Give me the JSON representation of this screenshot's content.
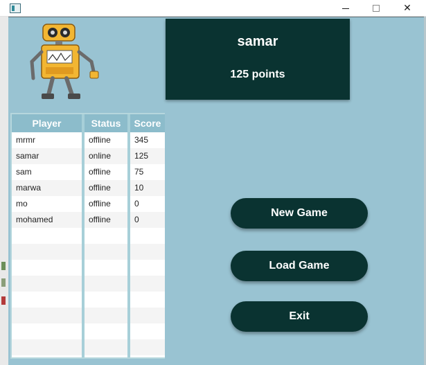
{
  "window": {
    "controls": {
      "minimize": "—",
      "maximize": "☐",
      "close": "✕"
    },
    "icon": "app-window-icon"
  },
  "colors": {
    "background": "#99c3d2",
    "card": "#0a3331",
    "table_header": "#8cbccb",
    "text_light": "#ffffff"
  },
  "header": {
    "player_name": "samar",
    "points": "125 points"
  },
  "mascot": {
    "icon": "robot-mascot-icon"
  },
  "table": {
    "columns": [
      "Player",
      "Status",
      "Score"
    ],
    "rows": [
      {
        "player": "mrmr",
        "status": "offline",
        "score": "345"
      },
      {
        "player": "samar",
        "status": "online",
        "score": "125"
      },
      {
        "player": "sam",
        "status": "offline",
        "score": "75"
      },
      {
        "player": "marwa",
        "status": "offline",
        "score": "10"
      },
      {
        "player": "mo",
        "status": "offline",
        "score": "0"
      },
      {
        "player": "mohamed",
        "status": "offline",
        "score": "0"
      }
    ]
  },
  "actions": {
    "new_game": "New Game",
    "load_game": "Load Game",
    "exit": "Exit"
  }
}
